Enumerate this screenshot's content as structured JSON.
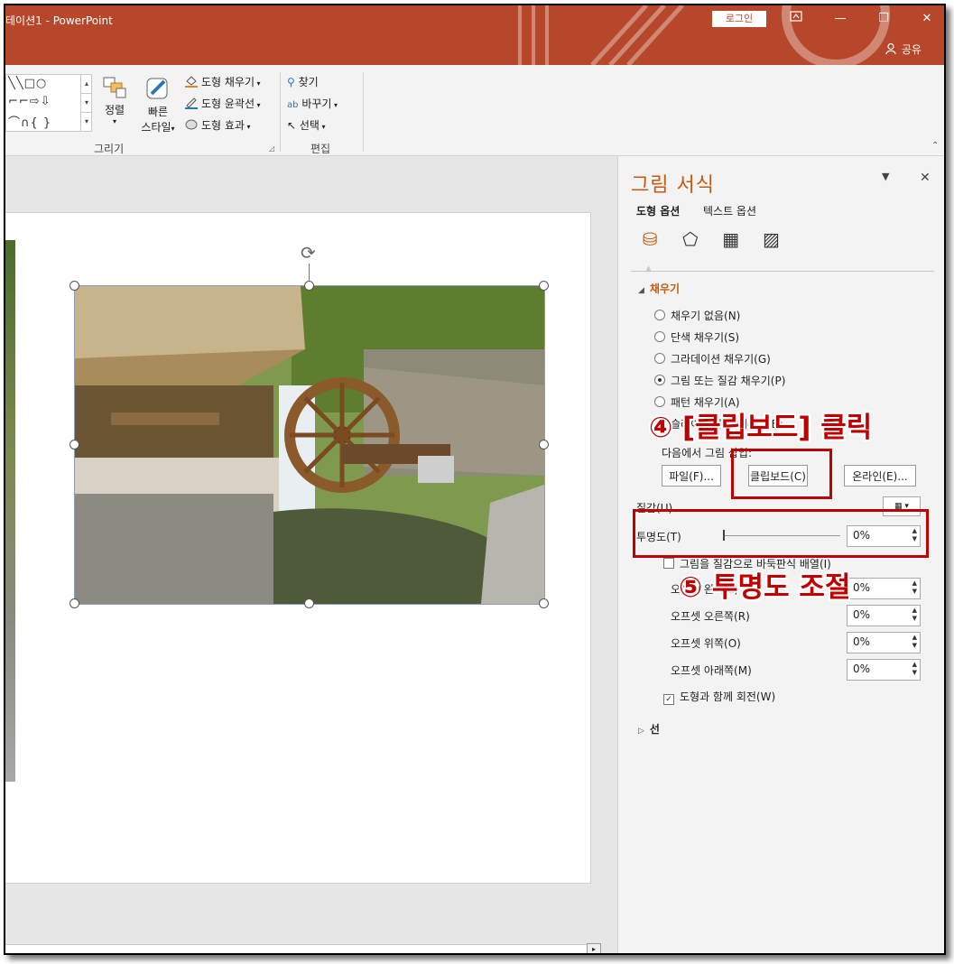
{
  "window": {
    "title": "테이션1  -  PowerPoint",
    "login": "로그인",
    "restore_ico": "ribbon-display-icon",
    "minimize": "—",
    "maximize": "❐",
    "close": "✕",
    "share": "공유"
  },
  "ribbon": {
    "shape_rows": [
      "╲╲□○",
      "⌐⌐⇨⇩",
      "⌒∩{ }"
    ],
    "arrange_label": "정렬",
    "quick_styles_line1": "빠른",
    "quick_styles_line2": "스타일",
    "shape_fill": "도형 채우기",
    "shape_outline": "도형 윤곽선",
    "shape_effects": "도형 효과",
    "find": "찾기",
    "replace": "바꾸기",
    "select": "선택",
    "group_drawing": "그리기",
    "group_editing": "편집"
  },
  "pane": {
    "title": "그림 서식",
    "tabs": [
      "도형 옵션",
      "텍스트 옵션"
    ],
    "fill_section": "채우기",
    "fill_options": [
      {
        "label": "채우기 없음(N)",
        "selected": false
      },
      {
        "label": "단색 채우기(S)",
        "selected": false
      },
      {
        "label": "그라데이션 채우기(G)",
        "selected": false
      },
      {
        "label": "그림 또는 질감 채우기(P)",
        "selected": true
      },
      {
        "label": "패턴 채우기(A)",
        "selected": false
      },
      {
        "label": "슬라이드 배경 채우기(B)",
        "selected": false
      }
    ],
    "insert_from": "다음에서 그림 삽입:",
    "btn_file": "파일(F)...",
    "btn_clipboard": "클립보드(C)",
    "btn_online": "온라인(E)...",
    "texture_label": "질감(U)",
    "transparency_label": "투명도(T)",
    "transparency_value": "0%",
    "transparency_fraction": 0,
    "tile_label": "그림을 질감으로 바둑판식 배열(I)",
    "offset_left_label": "오프셋 왼쪽(L)",
    "offset_left_value": "0%",
    "offset_right_label": "오프셋 오른쪽(R)",
    "offset_right_value": "0%",
    "offset_top_label": "오프셋 위쪽(O)",
    "offset_top_value": "0%",
    "offset_bottom_label": "오프셋 아래쪽(M)",
    "offset_bottom_value": "0%",
    "rotate_with_shape": "도형과 함께 회전(W)",
    "line_section": "선"
  },
  "annotations": {
    "step4": "④ [클립보드] 클릭",
    "step5": "⑤ 투명도 조절"
  },
  "colors": {
    "accent": "#b7472a",
    "pane_title": "#c55a11",
    "annotation": "#c00000"
  }
}
